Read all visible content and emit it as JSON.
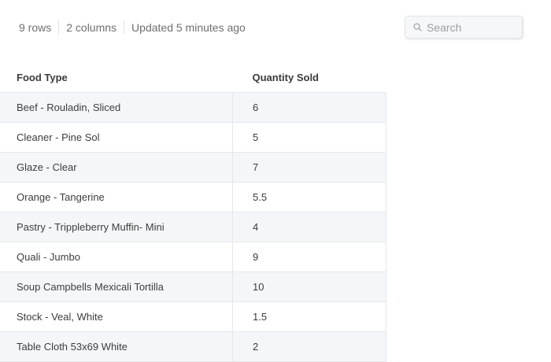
{
  "meta": {
    "rows": "9 rows",
    "columns": "2 columns",
    "updated": "Updated 5 minutes ago"
  },
  "search": {
    "placeholder": "Search",
    "value": "",
    "icon": "search-icon"
  },
  "table": {
    "headers": [
      "Food Type",
      "Quantity Sold"
    ],
    "rows": [
      [
        "Beef - Rouladin, Sliced",
        "6"
      ],
      [
        "Cleaner - Pine Sol",
        "5"
      ],
      [
        "Glaze - Clear",
        "7"
      ],
      [
        "Orange - Tangerine",
        "5.5"
      ],
      [
        "Pastry - Trippleberry Muffin- Mini",
        "4"
      ],
      [
        "Quali - Jumbo",
        "9"
      ],
      [
        "Soup Campbells Mexicali Tortilla",
        "10"
      ],
      [
        "Stock - Veal, White",
        "1.5"
      ],
      [
        "Table Cloth 53x69 White",
        "2"
      ]
    ]
  },
  "colors": {
    "row_stripe": "#f4f7f9",
    "border": "#e4e8eb",
    "muted_text": "#6f6f6f"
  }
}
